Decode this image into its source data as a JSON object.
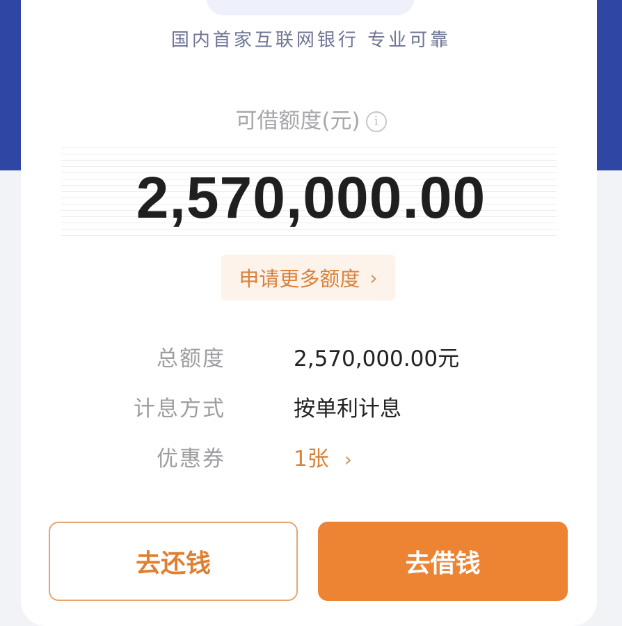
{
  "header": {
    "slogan": "国内首家互联网银行 专业可靠"
  },
  "quota": {
    "title": "可借额度(元)",
    "info_icon_glyph": "i",
    "amount": "2,570,000.00",
    "apply_more_label": "申请更多额度",
    "apply_more_chevron": "›"
  },
  "details": [
    {
      "label": "总额度",
      "value": "2,570,000.00元"
    },
    {
      "label": "计息方式",
      "value": "按单利计息"
    },
    {
      "label": "优惠券",
      "value": "1张"
    }
  ],
  "coupon_chevron": "›",
  "actions": {
    "repay_label": "去还钱",
    "borrow_label": "去借钱"
  },
  "colors": {
    "brand_blue": "#2f46a4",
    "accent_orange": "#ec8433",
    "text_dark": "#222222",
    "text_muted": "#9e9ea2"
  },
  "icons": [
    "info-icon",
    "chevron-right-icon"
  ]
}
